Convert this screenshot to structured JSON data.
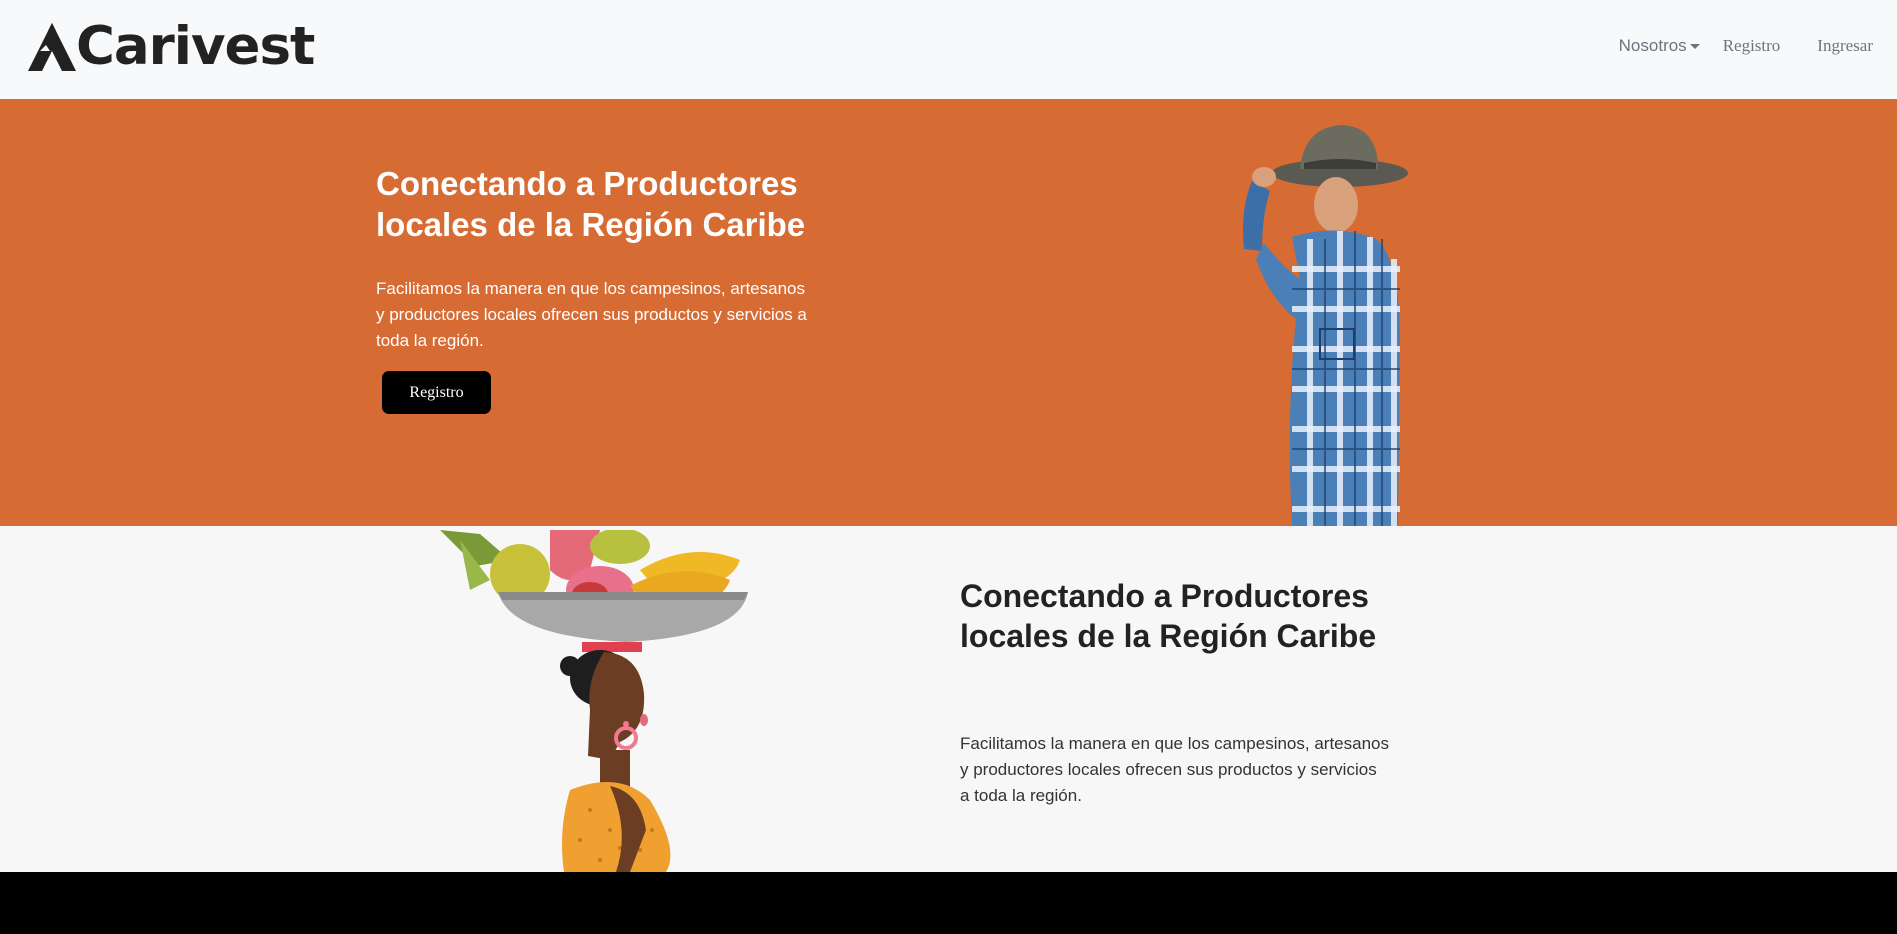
{
  "brand": {
    "name": "Carivest",
    "logo_icon": "mountain-a-icon"
  },
  "nav": {
    "dropdown_label": "Nosotros",
    "registro_label": "Registro",
    "ingresar_label": "Ingresar"
  },
  "hero": {
    "title": "Conectando a Productores locales de la Región Caribe",
    "text": "Facilitamos la manera en que los campesinos, artesanos y productores locales ofrecen sus productos y servicios a toda la región.",
    "button_label": "Registro"
  },
  "section2": {
    "title": "Conectando a Productores locales de la Región Caribe",
    "text": "Facilitamos la manera en que los campesinos, artesanos y productores locales ofrecen sus productos y servicios a toda la región."
  },
  "colors": {
    "hero_bg": "#d66c34",
    "navbar_bg": "#f8f9fa",
    "section_bg": "#f7f7f7",
    "button_bg": "#000000"
  }
}
